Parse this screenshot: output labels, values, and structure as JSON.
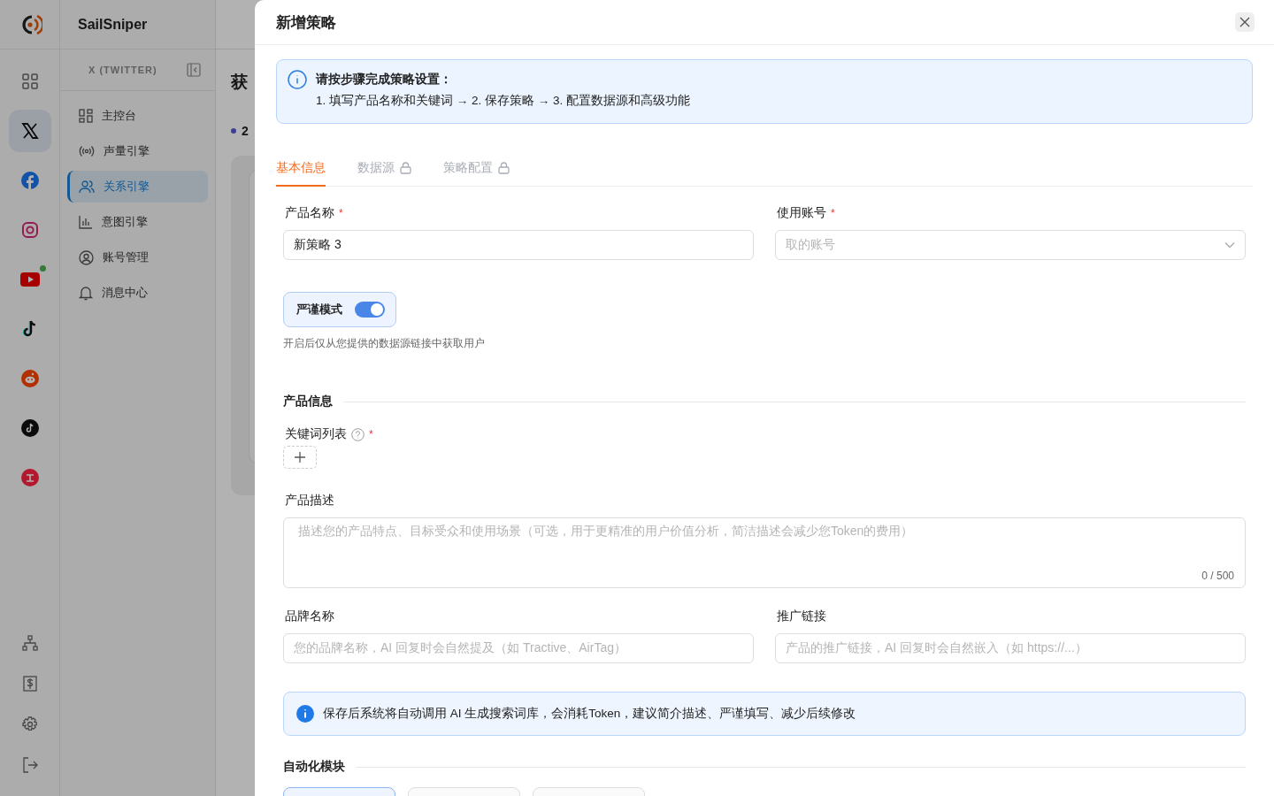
{
  "app": {
    "brand": "SailSniper"
  },
  "platform_rail": {
    "items": [
      {
        "kind": "grid",
        "selected": false,
        "notification": false
      },
      {
        "kind": "x",
        "selected": true,
        "notification": false
      },
      {
        "kind": "facebook",
        "selected": false,
        "notification": false
      },
      {
        "kind": "instagram",
        "selected": false,
        "notification": false
      },
      {
        "kind": "youtube",
        "selected": false,
        "notification": true
      },
      {
        "kind": "tiktok",
        "selected": false,
        "notification": false
      },
      {
        "kind": "reddit",
        "selected": false,
        "notification": false
      },
      {
        "kind": "tiktok-round",
        "selected": false,
        "notification": false
      },
      {
        "kind": "rednote",
        "selected": false,
        "notification": false
      }
    ],
    "tools": [
      {
        "kind": "sitemap"
      },
      {
        "kind": "billing"
      },
      {
        "kind": "settings"
      },
      {
        "kind": "logout"
      }
    ]
  },
  "nav": {
    "section": "X (TWITTER)",
    "items": [
      {
        "label": "主控台",
        "kind": "dashboard",
        "selected": false
      },
      {
        "label": "声量引擎",
        "kind": "broadcast",
        "selected": false
      },
      {
        "label": "关系引擎",
        "kind": "users",
        "selected": true
      },
      {
        "label": "意图引擎",
        "kind": "chart",
        "selected": false
      },
      {
        "label": "账号管理",
        "kind": "account",
        "selected": false
      },
      {
        "label": "消息中心",
        "kind": "bell",
        "selected": false
      }
    ]
  },
  "main": {
    "title": "获",
    "stat": "2"
  },
  "drawer": {
    "title": "新增策略",
    "notice": {
      "title": "请按步骤完成策略设置：",
      "text": "1. 填写产品名称和关键词 → 2. 保存策略 → 3. 配置数据源和高级功能"
    },
    "tabs": [
      {
        "label": "基本信息",
        "selected": true,
        "locked": false
      },
      {
        "label": "数据源",
        "selected": false,
        "locked": true
      },
      {
        "label": "策略配置",
        "selected": false,
        "locked": true
      }
    ],
    "product_name": {
      "label": "产品名称",
      "required_mark": "*",
      "value": "新策略 3"
    },
    "account": {
      "label": "使用账号",
      "required_mark": "*",
      "placeholder": "取的账号"
    },
    "strict_mode": {
      "label": "严谨模式",
      "on": true,
      "hint": "开启后仅从您提供的数据源链接中获取用户"
    },
    "product_info": {
      "heading": "产品信息"
    },
    "keywords": {
      "label": "关键词列表",
      "required_mark": "*"
    },
    "description": {
      "label": "产品描述",
      "placeholder": "描述您的产品特点、目标受众和使用场景（可选，用于更精准的用户价值分析，简洁描述会减少您Token的费用）",
      "counter": "0 / 500"
    },
    "brand": {
      "label": "品牌名称",
      "placeholder": "您的品牌名称，AI 回复时会自然提及（如 Tractive、AirTag）"
    },
    "promo_link": {
      "label": "推广链接",
      "placeholder": "产品的推广链接，AI 回复时会自然嵌入（如 https://...）"
    },
    "alert": "保存后系统将自动调用 AI 生成搜索词库，会消耗Token，建议简介描述、严谨填写、减少后续修改",
    "automation": {
      "heading": "自动化模块",
      "modules": [
        {
          "selected": true
        },
        {
          "selected": false
        },
        {
          "selected": false
        }
      ]
    }
  }
}
